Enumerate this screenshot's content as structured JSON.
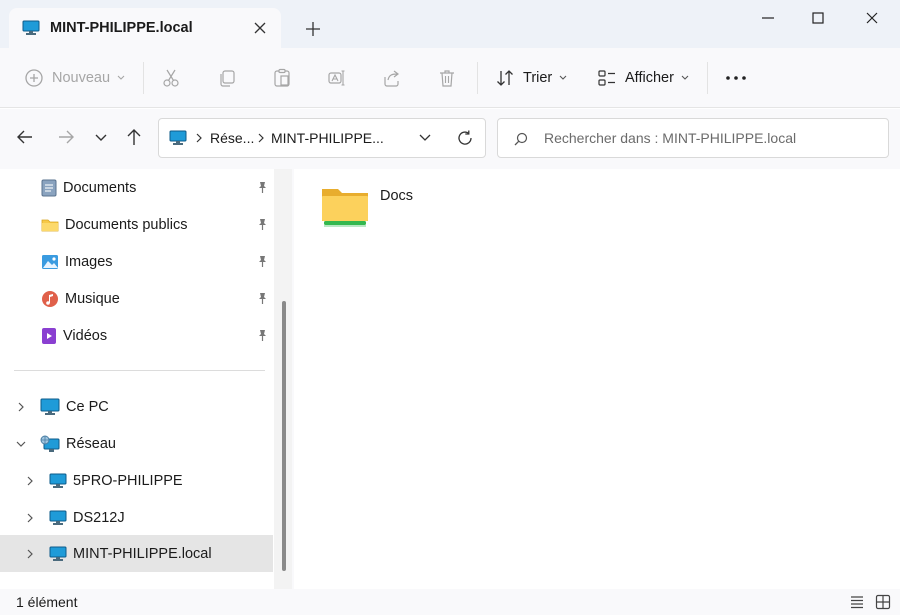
{
  "window": {
    "tab_title": "MINT-PHILIPPE.local"
  },
  "toolbar": {
    "new_label": "Nouveau",
    "sort_label": "Trier",
    "view_label": "Afficher"
  },
  "address": {
    "segments": [
      "Rése...",
      "MINT-PHILIPPE..."
    ]
  },
  "search": {
    "placeholder": "Rechercher dans : MINT-PHILIPPE.local"
  },
  "sidebar": {
    "quick_access": [
      {
        "label": "Documents",
        "icon": "documents-icon"
      },
      {
        "label": "Documents publics",
        "icon": "folder-icon"
      },
      {
        "label": "Images",
        "icon": "pictures-icon"
      },
      {
        "label": "Musique",
        "icon": "music-icon"
      },
      {
        "label": "Vidéos",
        "icon": "videos-icon"
      }
    ],
    "tree": [
      {
        "label": "Ce PC",
        "icon": "pc-icon",
        "expanded": false
      },
      {
        "label": "Réseau",
        "icon": "network-icon",
        "expanded": true
      },
      {
        "label": "5PRO-PHILIPPE",
        "icon": "computer-icon"
      },
      {
        "label": "DS212J",
        "icon": "computer-icon"
      },
      {
        "label": "MINT-PHILIPPE.local",
        "icon": "computer-icon",
        "selected": true
      }
    ]
  },
  "content": {
    "items": [
      {
        "name": "Docs",
        "icon": "shared-folder-icon"
      }
    ]
  },
  "status": {
    "count_text": "1 élément"
  },
  "colors": {
    "accent": "#0067c0",
    "folder": "#f7c948",
    "share": "#3ec35a"
  }
}
